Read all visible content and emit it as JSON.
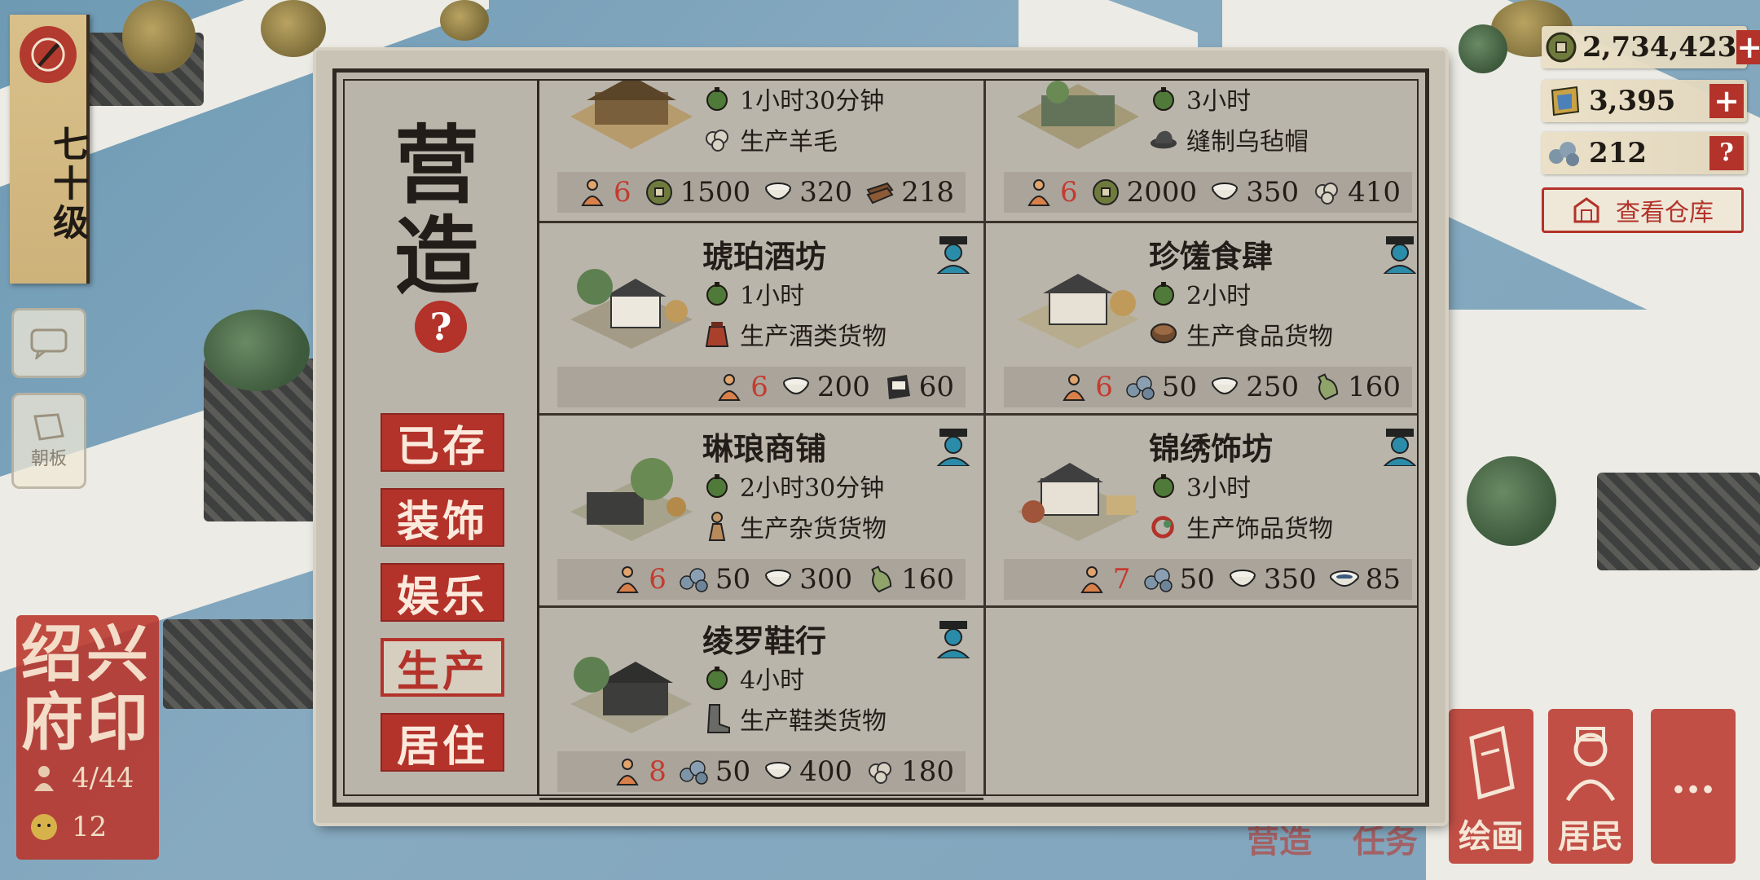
{
  "hud": {
    "level": "七十级",
    "city_name": "绍兴府印",
    "population": "4/44",
    "residents": "12",
    "side_board_label": "朝板"
  },
  "resources": {
    "coins": "2,734,423",
    "gems": "3,395",
    "stone": "212",
    "warehouse_label": "查看仓库"
  },
  "panel": {
    "title": "营造",
    "help": "?",
    "categories": [
      {
        "label": "已存",
        "active": false
      },
      {
        "label": "装饰",
        "active": false
      },
      {
        "label": "娱乐",
        "active": false
      },
      {
        "label": "生产",
        "active": true
      },
      {
        "label": "居住",
        "active": false
      }
    ],
    "cards": [
      {
        "name": "",
        "time": "1小时30分钟",
        "product": "生产羊毛",
        "workers": "6",
        "costs": [
          "1500",
          "320",
          "218"
        ]
      },
      {
        "name": "",
        "time": "3小时",
        "product": "缝制乌毡帽",
        "workers": "6",
        "costs": [
          "2000",
          "350",
          "410"
        ]
      },
      {
        "name": "琥珀酒坊",
        "time": "1小时",
        "product": "生产酒类货物",
        "workers": "6",
        "costs": [
          "200",
          "60"
        ]
      },
      {
        "name": "珍馐食肆",
        "time": "2小时",
        "product": "生产食品货物",
        "workers": "6",
        "costs": [
          "50",
          "250",
          "160"
        ]
      },
      {
        "name": "琳琅商铺",
        "time": "2小时30分钟",
        "product": "生产杂货货物",
        "workers": "6",
        "costs": [
          "50",
          "300",
          "160"
        ]
      },
      {
        "name": "锦绣饰坊",
        "time": "3小时",
        "product": "生产饰品货物",
        "workers": "7",
        "costs": [
          "50",
          "350",
          "85"
        ]
      },
      {
        "name": "绫罗鞋行",
        "time": "4小时",
        "product": "生产鞋类货物",
        "workers": "8",
        "costs": [
          "50",
          "400",
          "180"
        ]
      }
    ]
  },
  "bottom_bar": {
    "buttons": [
      "绘画",
      "居民",
      "···"
    ],
    "faded_tabs": [
      "营造",
      "任务"
    ]
  },
  "colors": {
    "accent_red": "#b3322a",
    "ink": "#221d18",
    "paper": "#c9c3b6"
  }
}
